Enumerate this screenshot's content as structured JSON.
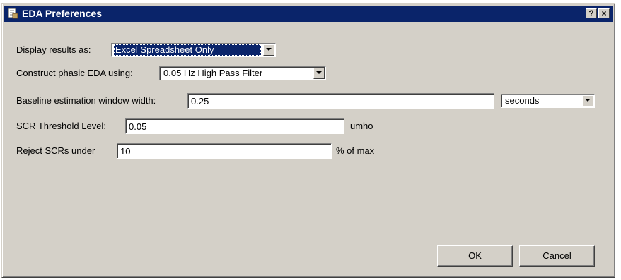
{
  "window": {
    "title": "EDA Preferences",
    "help_glyph": "?",
    "close_glyph": "×"
  },
  "display_results": {
    "label": "Display results as:",
    "value": "Excel Spreadsheet Only"
  },
  "construct_phasic": {
    "label": "Construct phasic EDA using:",
    "value": "0.05 Hz High Pass Filter"
  },
  "baseline": {
    "label": "Baseline estimation window width:",
    "value": "0.25",
    "unit_value": "seconds"
  },
  "scr_threshold": {
    "label": "SCR Threshold Level:",
    "value": "0.05",
    "unit": "umho"
  },
  "reject_scrs": {
    "label": "Reject SCRs under",
    "value": "10",
    "unit": "% of max"
  },
  "buttons": {
    "ok": "OK",
    "cancel": "Cancel"
  },
  "icons": {
    "app": "dialog-app-icon",
    "dropdown": "chevron-down-icon"
  },
  "colors": {
    "titlebar": "#0a246a",
    "face": "#d4d0c8",
    "selection": "#0a246a"
  }
}
